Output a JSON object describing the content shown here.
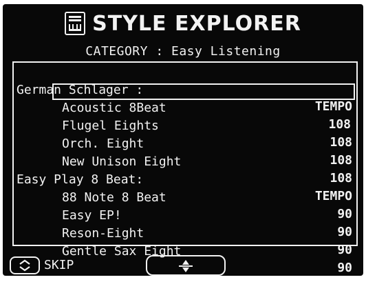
{
  "header": {
    "title": "STYLE EXPLORER",
    "icon": "style-keyboard-icon"
  },
  "category": {
    "label": "CATEGORY",
    "separator": ":",
    "value": "Easy Listening"
  },
  "groups": [
    {
      "name": "German Schlager :",
      "tempo_label": "TEMPO",
      "items": [
        {
          "name": "Acoustic 8Beat",
          "tempo": "108",
          "selected": true
        },
        {
          "name": "Flugel Eights",
          "tempo": "108",
          "selected": false
        },
        {
          "name": "Orch. Eight",
          "tempo": "108",
          "selected": false
        },
        {
          "name": "New Unison Eight",
          "tempo": "108",
          "selected": false
        }
      ]
    },
    {
      "name": "Easy Play 8 Beat:",
      "tempo_label": "TEMPO",
      "items": [
        {
          "name": "88 Note 8 Beat",
          "tempo": "90",
          "selected": false
        },
        {
          "name": "Easy EP!",
          "tempo": "90",
          "selected": false
        },
        {
          "name": "Reson-Eight",
          "tempo": "90",
          "selected": false
        },
        {
          "name": "Gentle Sax Eight",
          "tempo": "90",
          "selected": false
        }
      ]
    }
  ],
  "footer": {
    "skip_label": "SKIP",
    "skip_icon": "up-down-chevron-icon",
    "scroll_icon": "up-down-triangle-icon"
  },
  "colors": {
    "background": "#080808",
    "foreground": "#f2f2f2"
  }
}
